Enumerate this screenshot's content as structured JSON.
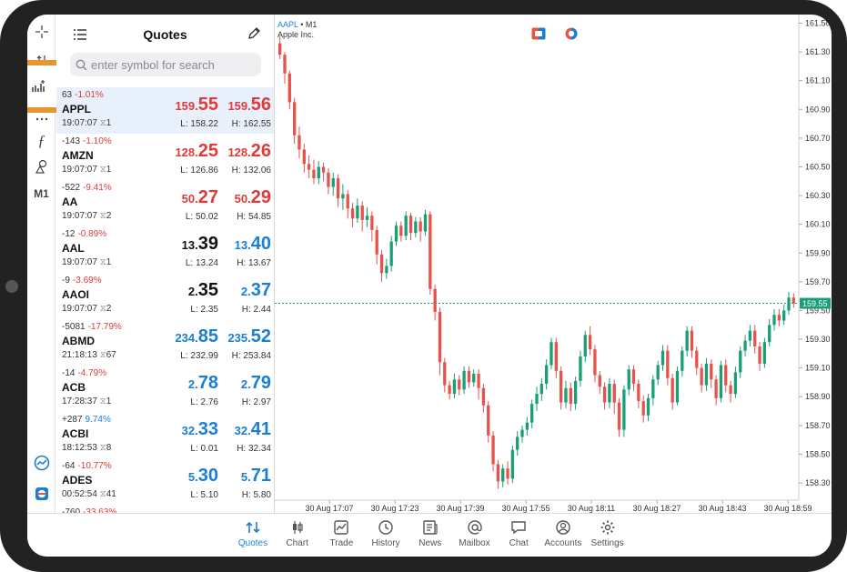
{
  "quotes_panel": {
    "title": "Quotes",
    "search_placeholder": "enter symbol for search",
    "rows": [
      {
        "chg": "63",
        "pct": "-1.01%",
        "pct_dir": "down",
        "symbol": "APPL",
        "time": "19:07:07",
        "vol": "1",
        "bid_main": "159.",
        "bid_big": "55",
        "ask_main": "159.",
        "ask_big": "56",
        "color": "red",
        "low": "L: 158.22",
        "high": "H: 162.55",
        "selected": true
      },
      {
        "chg": "-143",
        "pct": "-1.10%",
        "pct_dir": "down",
        "symbol": "AMZN",
        "time": "19:07:07",
        "vol": "1",
        "bid_main": "128.",
        "bid_big": "25",
        "ask_main": "128.",
        "ask_big": "26",
        "color": "red",
        "low": "L: 126.86",
        "high": "H: 132.06"
      },
      {
        "chg": "-522",
        "pct": "-9.41%",
        "pct_dir": "down",
        "symbol": "AA",
        "time": "19:07:07",
        "vol": "2",
        "bid_main": "50.",
        "bid_big": "27",
        "ask_main": "50.",
        "ask_big": "29",
        "color": "red",
        "low": "L: 50.02",
        "high": "H: 54.85"
      },
      {
        "chg": "-12",
        "pct": "-0.89%",
        "pct_dir": "down",
        "symbol": "AAL",
        "time": "19:07:07",
        "vol": "1",
        "bid_main": "13.",
        "bid_big": "39",
        "ask_main": "13.",
        "ask_big": "40",
        "color": "mixed",
        "low": "L: 13.24",
        "high": "H: 13.67"
      },
      {
        "chg": "-9",
        "pct": "-3.69%",
        "pct_dir": "down",
        "symbol": "AAOI",
        "time": "19:07:07",
        "vol": "2",
        "bid_main": "2.",
        "bid_big": "35",
        "ask_main": "2.",
        "ask_big": "37",
        "color": "mixed",
        "low": "L: 2.35",
        "high": "H: 2.44"
      },
      {
        "chg": "-5081",
        "pct": "-17.79%",
        "pct_dir": "down",
        "symbol": "ABMD",
        "time": "21:18:13",
        "vol": "67",
        "bid_main": "234.",
        "bid_big": "85",
        "ask_main": "235.",
        "ask_big": "52",
        "color": "blue",
        "low": "L: 232.99",
        "high": "H: 253.84"
      },
      {
        "chg": "-14",
        "pct": "-4.79%",
        "pct_dir": "down",
        "symbol": "ACB",
        "time": "17:28:37",
        "vol": "1",
        "bid_main": "2.",
        "bid_big": "78",
        "ask_main": "2.",
        "ask_big": "79",
        "color": "blue",
        "low": "L: 2.76",
        "high": "H: 2.97"
      },
      {
        "chg": "+287",
        "pct": "9.74%",
        "pct_dir": "up",
        "symbol": "ACBI",
        "time": "18:12:53",
        "vol": "8",
        "bid_main": "32.",
        "bid_big": "33",
        "ask_main": "32.",
        "ask_big": "41",
        "color": "blue",
        "low": "L: 0.01",
        "high": "H: 32.34"
      },
      {
        "chg": "-64",
        "pct": "-10.77%",
        "pct_dir": "down",
        "symbol": "ADES",
        "time": "00:52:54",
        "vol": "41",
        "bid_main": "5.",
        "bid_big": "30",
        "ask_main": "5.",
        "ask_big": "71",
        "color": "blue",
        "low": "L: 5.10",
        "high": "H: 5.80"
      },
      {
        "chg": "-760",
        "pct": "-33.63%",
        "pct_dir": "down",
        "symbol": "",
        "time": "",
        "vol": "",
        "bid_main": "",
        "bid_big": "",
        "ask_main": "",
        "ask_big": "",
        "color": "blue",
        "low": "",
        "high": ""
      }
    ]
  },
  "chart_header": {
    "symbol": "AAPL",
    "timeframe": "• M1",
    "name": "Apple Inc."
  },
  "rail": {
    "m1_label": "M1"
  },
  "chart_data": {
    "type": "candlestick",
    "symbol": "AAPL",
    "timeframe": "M1",
    "y_ticks": [
      "161.50",
      "161.30",
      "161.10",
      "160.90",
      "160.70",
      "160.50",
      "160.30",
      "160.10",
      "159.90",
      "159.70",
      "159.50",
      "159.30",
      "159.10",
      "158.90",
      "158.70",
      "158.50",
      "158.30"
    ],
    "x_ticks": [
      "30 Aug 17:07",
      "30 Aug 17:23",
      "30 Aug 17:39",
      "30 Aug 17:55",
      "30 Aug 18:11",
      "30 Aug 18:27",
      "30 Aug 18:43",
      "30 Aug 18:59"
    ],
    "ylim": [
      158.18,
      161.56
    ],
    "current_price": "159.55",
    "candles": [
      [
        161.36,
        161.28,
        161.41,
        161.25
      ],
      [
        161.28,
        161.15,
        161.3,
        161.08
      ],
      [
        161.15,
        160.95,
        161.17,
        160.9
      ],
      [
        160.95,
        160.72,
        160.98,
        160.66
      ],
      [
        160.72,
        160.62,
        160.78,
        160.56
      ],
      [
        160.62,
        160.52,
        160.66,
        160.46
      ],
      [
        160.52,
        160.48,
        160.58,
        160.42
      ],
      [
        160.48,
        160.42,
        160.55,
        160.38
      ],
      [
        160.42,
        160.5,
        160.54,
        160.38
      ],
      [
        160.5,
        160.46,
        160.53,
        160.4
      ],
      [
        160.46,
        160.36,
        160.49,
        160.31
      ],
      [
        160.36,
        160.42,
        160.46,
        160.3
      ],
      [
        160.42,
        160.28,
        160.45,
        160.22
      ],
      [
        160.28,
        160.31,
        160.38,
        160.2
      ],
      [
        160.31,
        160.21,
        160.34,
        160.14
      ],
      [
        160.21,
        160.14,
        160.25,
        160.08
      ],
      [
        160.14,
        160.23,
        160.28,
        160.11
      ],
      [
        160.23,
        160.13,
        160.26,
        160.05
      ],
      [
        160.13,
        160.16,
        160.22,
        160.08
      ],
      [
        160.16,
        160.06,
        160.19,
        159.98
      ],
      [
        160.06,
        159.89,
        160.09,
        159.82
      ],
      [
        159.89,
        159.76,
        159.92,
        159.7
      ],
      [
        159.76,
        159.81,
        159.86,
        159.72
      ],
      [
        159.81,
        159.98,
        160.02,
        159.77
      ],
      [
        159.98,
        160.09,
        160.12,
        159.95
      ],
      [
        160.09,
        160.02,
        160.12,
        159.98
      ],
      [
        160.02,
        160.16,
        160.19,
        159.99
      ],
      [
        160.16,
        160.04,
        160.18,
        159.99
      ],
      [
        160.04,
        160.12,
        160.15,
        160.01
      ],
      [
        160.12,
        160.05,
        160.15,
        159.98
      ],
      [
        160.05,
        160.17,
        160.2,
        160.02
      ],
      [
        160.17,
        159.65,
        160.19,
        159.61
      ],
      [
        159.65,
        159.49,
        159.68,
        159.43
      ],
      [
        159.49,
        159.14,
        159.52,
        159.05
      ],
      [
        159.14,
        158.98,
        159.17,
        158.93
      ],
      [
        158.98,
        158.92,
        159.01,
        158.88
      ],
      [
        158.92,
        159.02,
        159.06,
        158.89
      ],
      [
        159.02,
        158.95,
        159.05,
        158.91
      ],
      [
        158.95,
        159.08,
        159.11,
        158.92
      ],
      [
        159.08,
        159.0,
        159.11,
        158.96
      ],
      [
        159.0,
        159.06,
        159.09,
        158.97
      ],
      [
        159.06,
        158.96,
        159.09,
        158.88
      ],
      [
        158.96,
        158.84,
        158.99,
        158.79
      ],
      [
        158.84,
        158.63,
        158.87,
        158.58
      ],
      [
        158.63,
        158.43,
        158.66,
        158.38
      ],
      [
        158.43,
        158.31,
        158.46,
        158.26
      ],
      [
        158.31,
        158.4,
        158.43,
        158.27
      ],
      [
        158.4,
        158.33,
        158.45,
        158.29
      ],
      [
        158.33,
        158.53,
        158.56,
        158.3
      ],
      [
        158.53,
        158.62,
        158.66,
        158.49
      ],
      [
        158.62,
        158.67,
        158.7,
        158.58
      ],
      [
        158.67,
        158.72,
        158.76,
        158.63
      ],
      [
        158.72,
        158.85,
        158.88,
        158.68
      ],
      [
        158.85,
        158.92,
        158.97,
        158.8
      ],
      [
        158.92,
        158.99,
        159.03,
        158.87
      ],
      [
        158.99,
        159.12,
        159.16,
        158.95
      ],
      [
        159.12,
        159.28,
        159.31,
        159.09
      ],
      [
        159.28,
        159.08,
        159.31,
        159.03
      ],
      [
        159.08,
        158.86,
        159.11,
        158.81
      ],
      [
        158.86,
        158.96,
        159.01,
        158.82
      ],
      [
        158.96,
        158.85,
        159.0,
        158.8
      ],
      [
        158.85,
        159.01,
        159.04,
        158.81
      ],
      [
        159.01,
        159.18,
        159.22,
        158.97
      ],
      [
        159.18,
        159.33,
        159.36,
        159.14
      ],
      [
        159.33,
        159.23,
        159.39,
        159.19
      ],
      [
        159.23,
        159.05,
        159.26,
        159.0
      ],
      [
        159.05,
        158.97,
        159.08,
        158.92
      ],
      [
        158.97,
        158.86,
        159.0,
        158.81
      ],
      [
        158.86,
        158.99,
        159.03,
        158.82
      ],
      [
        158.99,
        158.86,
        159.02,
        158.78
      ],
      [
        158.86,
        158.67,
        158.89,
        158.62
      ],
      [
        158.67,
        158.95,
        158.98,
        158.62
      ],
      [
        158.95,
        159.09,
        159.12,
        158.91
      ],
      [
        159.09,
        158.99,
        159.12,
        158.94
      ],
      [
        158.99,
        158.87,
        159.02,
        158.82
      ],
      [
        158.87,
        158.77,
        158.91,
        158.72
      ],
      [
        158.77,
        158.89,
        158.92,
        158.73
      ],
      [
        158.89,
        159.02,
        159.05,
        158.84
      ],
      [
        159.02,
        159.12,
        159.15,
        158.98
      ],
      [
        159.12,
        159.22,
        159.26,
        159.08
      ],
      [
        159.22,
        159.03,
        159.26,
        158.98
      ],
      [
        159.03,
        158.86,
        159.06,
        158.81
      ],
      [
        158.86,
        159.08,
        159.11,
        158.84
      ],
      [
        159.08,
        159.22,
        159.25,
        159.04
      ],
      [
        159.22,
        159.36,
        159.39,
        159.18
      ],
      [
        159.36,
        159.22,
        159.39,
        159.17
      ],
      [
        159.22,
        159.1,
        159.25,
        159.05
      ],
      [
        159.1,
        158.98,
        159.13,
        158.93
      ],
      [
        158.98,
        159.13,
        159.17,
        158.94
      ],
      [
        159.13,
        159.02,
        159.16,
        158.96
      ],
      [
        159.02,
        158.89,
        159.05,
        158.84
      ],
      [
        158.89,
        159.12,
        159.15,
        158.86
      ],
      [
        159.12,
        158.98,
        159.16,
        158.93
      ],
      [
        158.98,
        158.92,
        159.01,
        158.86
      ],
      [
        158.92,
        159.07,
        159.11,
        158.89
      ],
      [
        159.07,
        159.22,
        159.25,
        159.03
      ],
      [
        159.22,
        159.29,
        159.33,
        159.18
      ],
      [
        159.29,
        159.36,
        159.4,
        159.25
      ],
      [
        159.36,
        159.25,
        159.4,
        159.2
      ],
      [
        159.25,
        159.13,
        159.28,
        159.08
      ],
      [
        159.13,
        159.28,
        159.31,
        159.1
      ],
      [
        159.28,
        159.4,
        159.44,
        159.25
      ],
      [
        159.4,
        159.47,
        159.51,
        159.36
      ],
      [
        159.47,
        159.43,
        159.51,
        159.39
      ],
      [
        159.43,
        159.5,
        159.54,
        159.4
      ],
      [
        159.5,
        159.59,
        159.63,
        159.47
      ],
      [
        159.59,
        159.55,
        159.62,
        159.52
      ]
    ]
  },
  "tabs": [
    {
      "label": "Quotes",
      "icon": "quotes-icon",
      "active": true
    },
    {
      "label": "Chart",
      "icon": "candles-icon"
    },
    {
      "label": "Trade",
      "icon": "trade-icon"
    },
    {
      "label": "History",
      "icon": "history-icon"
    },
    {
      "label": "News",
      "icon": "news-icon"
    },
    {
      "label": "Mailbox",
      "icon": "mailbox-icon"
    },
    {
      "label": "Chat",
      "icon": "chat-icon"
    },
    {
      "label": "Accounts",
      "icon": "accounts-icon"
    },
    {
      "label": "Settings",
      "icon": "settings-icon"
    }
  ],
  "colors": {
    "up": "#1a9e77",
    "down": "#e5534b",
    "accent": "#1a7fd4",
    "highlight": "#e8952d"
  }
}
